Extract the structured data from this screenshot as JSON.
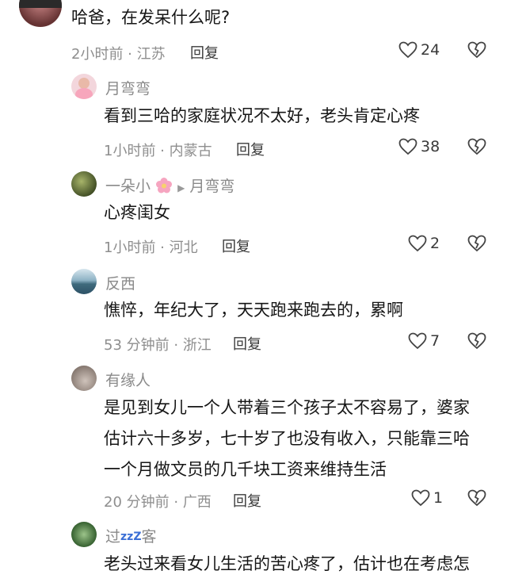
{
  "comments": [
    {
      "text": "哈爸，在发呆什么呢?",
      "time": "2小时前",
      "location": "江苏",
      "reply": "回复",
      "likes": "24"
    },
    {
      "name": "月弯弯",
      "text": "看到三哈的家庭状况不太好，老头肯定心疼",
      "time": "1小时前",
      "location": "内蒙古",
      "reply": "回复",
      "likes": "38"
    },
    {
      "name": "一朵小",
      "reply_to": "月弯弯",
      "text": "心疼闺女",
      "time": "1小时前",
      "location": "河北",
      "reply": "回复",
      "likes": "2"
    },
    {
      "name": "反西",
      "text": "憔悴，年纪大了，天天跑来跑去的，累啊",
      "time": "53 分钟前",
      "location": "浙江",
      "reply": "回复",
      "likes": "7"
    },
    {
      "name": "有缘人",
      "lines": [
        "是见到女儿一个人带着三个孩子太不容易了，婆家",
        "估计六十多岁，七十岁了也没有收入，只能靠三哈",
        "一个月做文员的几千块工资来维持生活"
      ],
      "time": "20 分钟前",
      "location": "广西",
      "reply": "回复",
      "likes": "1"
    },
    {
      "name_prefix": "过",
      "name_zzz": "zzZ",
      "name_suffix": "客",
      "text": "老头过来看女儿生活的苦心疼了，估计也在考虑怎"
    }
  ],
  "meta_separator": " · ",
  "icons": [
    "heart-outline-icon",
    "broken-heart-icon",
    "flower-emoji",
    "reply-arrow-icon"
  ]
}
